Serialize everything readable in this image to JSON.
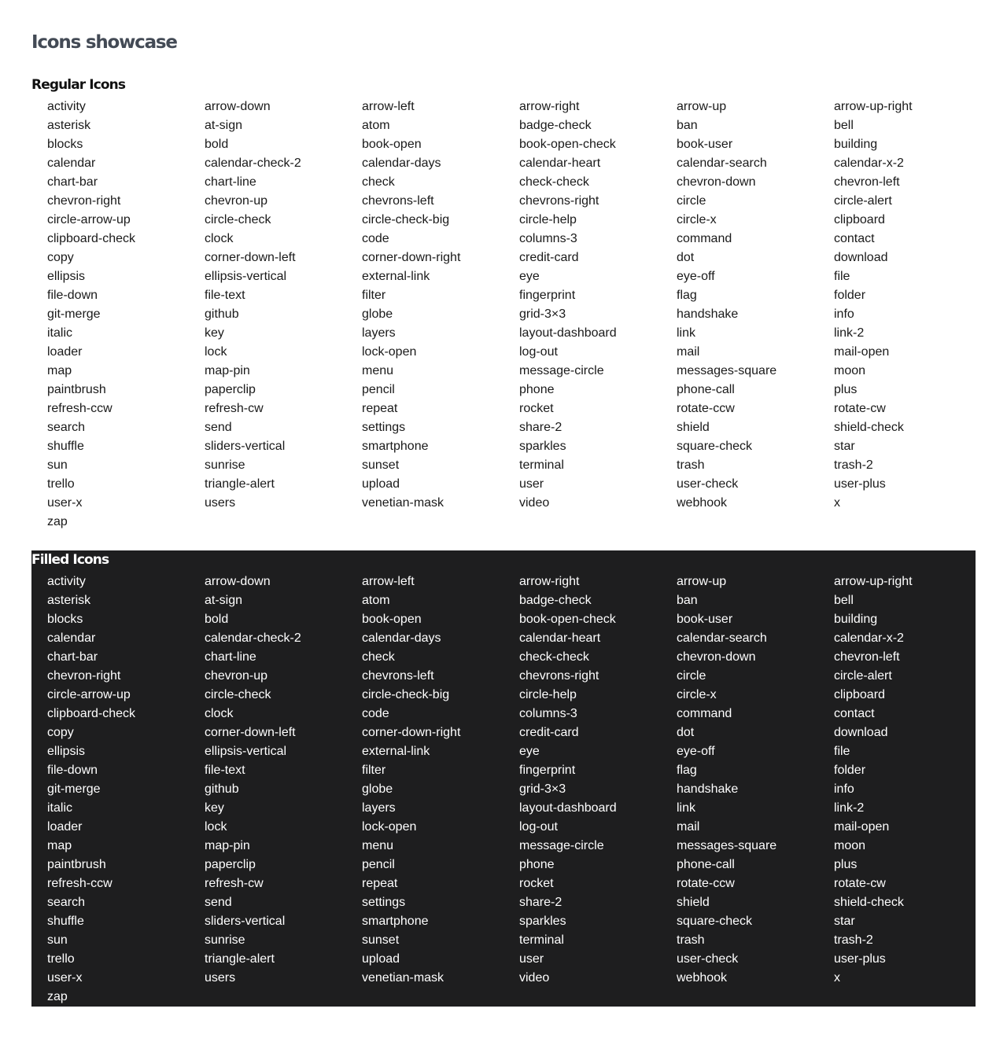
{
  "page": {
    "title": "Icons showcase"
  },
  "sections": {
    "regular": {
      "title": "Regular Icons",
      "background": "#ffffff"
    },
    "filled": {
      "title": "Filled Icons",
      "background": "#1e1e1f"
    }
  },
  "icons": [
    "activity",
    "arrow-down",
    "arrow-left",
    "arrow-right",
    "arrow-up",
    "arrow-up-right",
    "asterisk",
    "at-sign",
    "atom",
    "badge-check",
    "ban",
    "bell",
    "blocks",
    "bold",
    "book-open",
    "book-open-check",
    "book-user",
    "building",
    "calendar",
    "calendar-check-2",
    "calendar-days",
    "calendar-heart",
    "calendar-search",
    "calendar-x-2",
    "chart-bar",
    "chart-line",
    "check",
    "check-check",
    "chevron-down",
    "chevron-left",
    "chevron-right",
    "chevron-up",
    "chevrons-left",
    "chevrons-right",
    "circle",
    "circle-alert",
    "circle-arrow-up",
    "circle-check",
    "circle-check-big",
    "circle-help",
    "circle-x",
    "clipboard",
    "clipboard-check",
    "clock",
    "code",
    "columns-3",
    "command",
    "contact",
    "copy",
    "corner-down-left",
    "corner-down-right",
    "credit-card",
    "dot",
    "download",
    "ellipsis",
    "ellipsis-vertical",
    "external-link",
    "eye",
    "eye-off",
    "file",
    "file-down",
    "file-text",
    "filter",
    "fingerprint",
    "flag",
    "folder",
    "git-merge",
    "github",
    "globe",
    "grid-3×3",
    "handshake",
    "info",
    "italic",
    "key",
    "layers",
    "layout-dashboard",
    "link",
    "link-2",
    "loader",
    "lock",
    "lock-open",
    "log-out",
    "mail",
    "mail-open",
    "map",
    "map-pin",
    "menu",
    "message-circle",
    "messages-square",
    "moon",
    "paintbrush",
    "paperclip",
    "pencil",
    "phone",
    "phone-call",
    "plus",
    "refresh-ccw",
    "refresh-cw",
    "repeat",
    "rocket",
    "rotate-ccw",
    "rotate-cw",
    "search",
    "send",
    "settings",
    "share-2",
    "shield",
    "shield-check",
    "shuffle",
    "sliders-vertical",
    "smartphone",
    "sparkles",
    "square-check",
    "star",
    "sun",
    "sunrise",
    "sunset",
    "terminal",
    "trash",
    "trash-2",
    "trello",
    "triangle-alert",
    "upload",
    "user",
    "user-check",
    "user-plus",
    "user-x",
    "users",
    "venetian-mask",
    "video",
    "webhook",
    "x",
    "zap"
  ]
}
